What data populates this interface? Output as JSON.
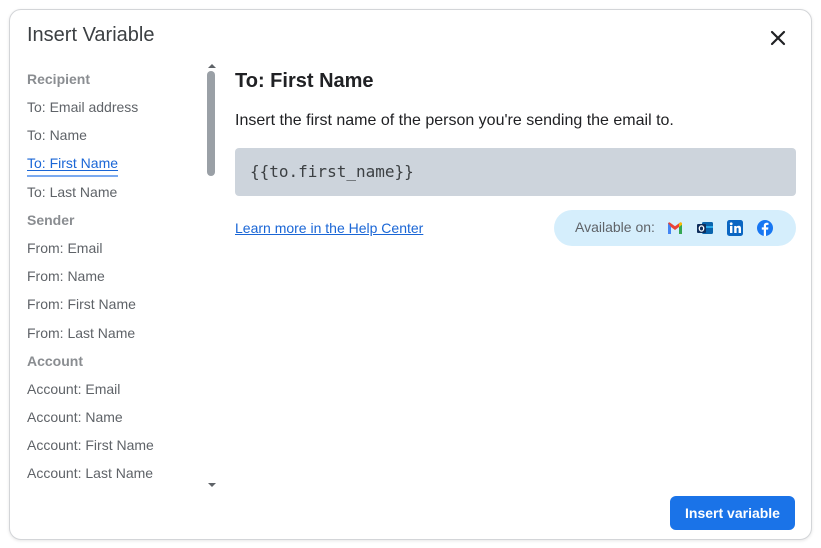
{
  "dialog": {
    "title": "Insert Variable",
    "close_icon": "close-icon"
  },
  "sidebar": {
    "groups": [
      {
        "heading": "Recipient",
        "items": [
          "To: Email address",
          "To: Name",
          "To: First Name",
          "To: Last Name"
        ]
      },
      {
        "heading": "Sender",
        "items": [
          "From: Email",
          "From: Name",
          "From: First Name",
          "From: Last Name"
        ]
      },
      {
        "heading": "Account",
        "items": [
          "Account: Email",
          "Account: Name",
          "Account: First Name",
          "Account: Last Name"
        ]
      }
    ],
    "selected": "To: First Name"
  },
  "detail": {
    "title": "To: First Name",
    "description": "Insert the first name of the person you're sending the email to.",
    "code": "{{to.first_name}}",
    "help_link": "Learn more in the Help Center",
    "available_label": "Available on:",
    "services": [
      "gmail-icon",
      "outlook-icon",
      "linkedin-icon",
      "facebook-icon"
    ]
  },
  "footer": {
    "insert_label": "Insert variable"
  },
  "colors": {
    "accent": "#1a73e8",
    "link": "#1a66d6",
    "code_bg": "#cdd4dc",
    "pill_bg": "#d5eefc"
  }
}
